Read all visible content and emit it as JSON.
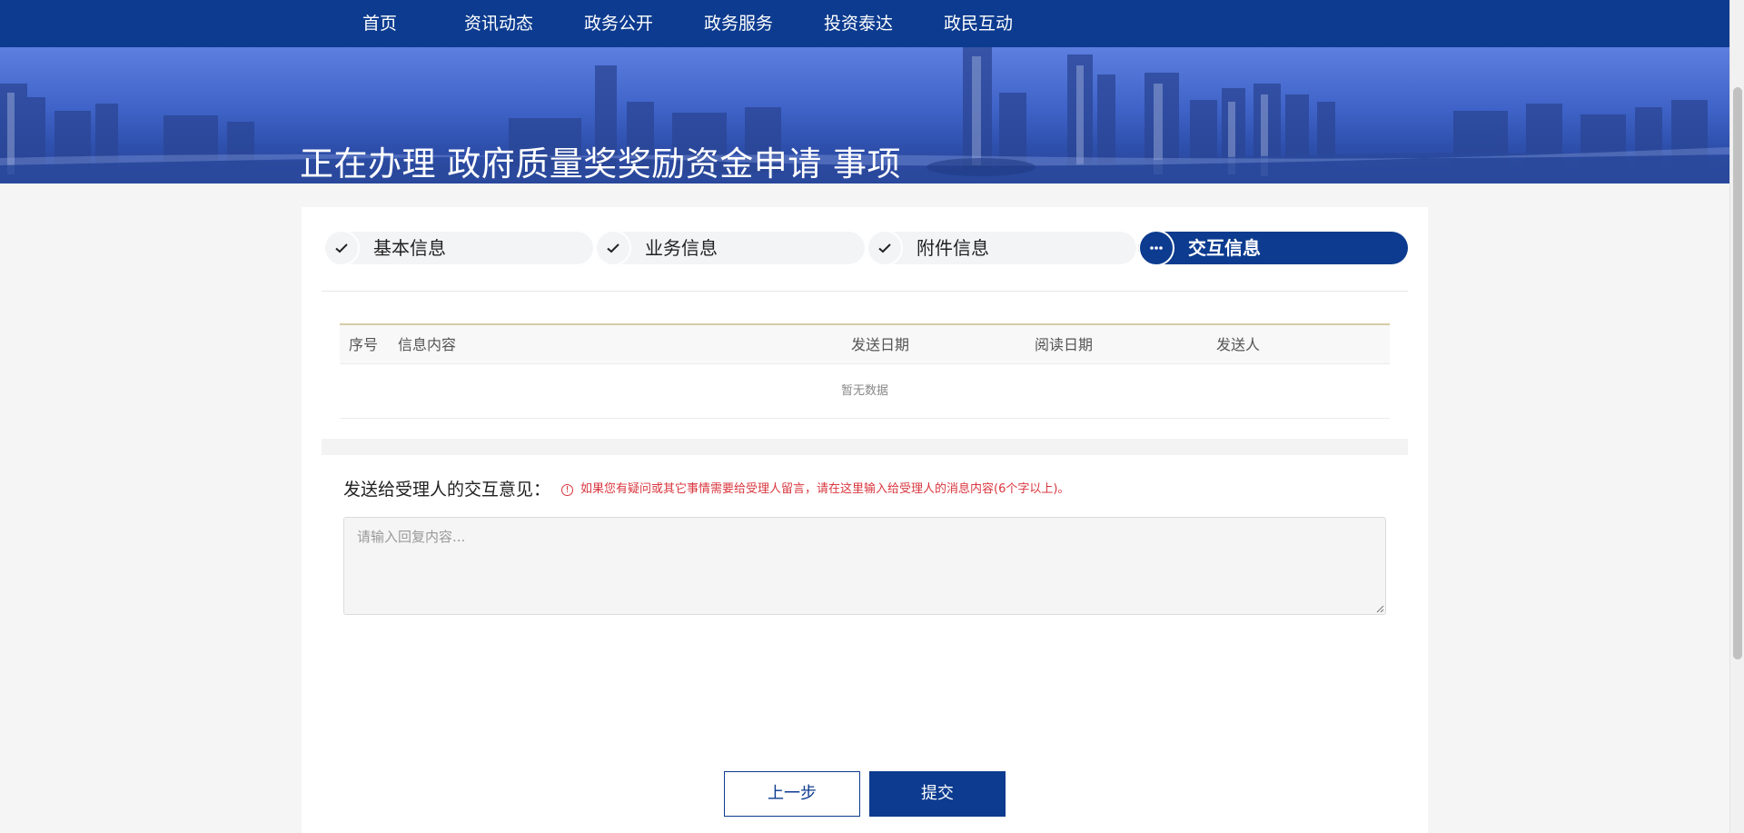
{
  "nav": {
    "items": [
      "首页",
      "资讯动态",
      "政务公开",
      "政务服务",
      "投资泰达",
      "政民互动"
    ]
  },
  "banner": {
    "title": "正在办理 政府质量奖奖励资金申请 事项"
  },
  "steps": [
    {
      "label": "基本信息",
      "status": "done",
      "icon": "check-icon"
    },
    {
      "label": "业务信息",
      "status": "done",
      "icon": "check-icon"
    },
    {
      "label": "附件信息",
      "status": "done",
      "icon": "check-icon"
    },
    {
      "label": "交互信息",
      "status": "active",
      "icon": "ellipsis-icon"
    }
  ],
  "table": {
    "columns": [
      "序号",
      "信息内容",
      "发送日期",
      "阅读日期",
      "发送人"
    ],
    "empty_text": "暂无数据"
  },
  "message": {
    "label": "发送给受理人的交互意见：",
    "hint": "如果您有疑问或其它事情需要给受理人留言，请在这里输入给受理人的消息内容(6个字以上)。",
    "hint_icon": "warning-circle-icon",
    "placeholder": "请输入回复内容...",
    "value": ""
  },
  "buttons": {
    "prev": "上一步",
    "submit": "提交"
  },
  "colors": {
    "primary": "#0c3b8f",
    "hint_red": "#d9363e",
    "table_top_border": "#d8cba6"
  }
}
